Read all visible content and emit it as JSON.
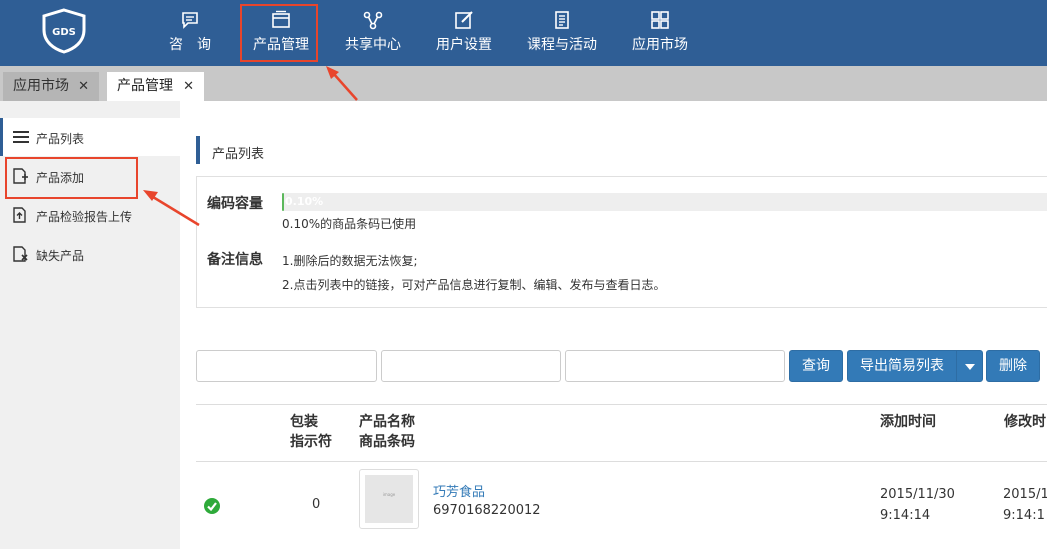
{
  "nav": {
    "logo_text": "GDS",
    "items": [
      {
        "label": "咨　询",
        "icon": "chat-icon"
      },
      {
        "label": "产品管理",
        "icon": "window-icon"
      },
      {
        "label": "共享中心",
        "icon": "share-icon"
      },
      {
        "label": "用户设置",
        "icon": "edit-icon"
      },
      {
        "label": "课程与活动",
        "icon": "document-icon"
      },
      {
        "label": "应用市场",
        "icon": "grid-icon"
      }
    ]
  },
  "tabs": [
    {
      "label": "应用市场",
      "close": "✕"
    },
    {
      "label": "产品管理",
      "close": "✕"
    }
  ],
  "sidebar": {
    "items": [
      {
        "label": "产品列表",
        "icon": "list-icon"
      },
      {
        "label": "产品添加",
        "icon": "add-document-icon"
      },
      {
        "label": "产品检验报告上传",
        "icon": "upload-document-icon"
      },
      {
        "label": "缺失产品",
        "icon": "missing-document-icon"
      }
    ]
  },
  "main": {
    "section_title": "产品列表",
    "info": {
      "capacity_label": "编码容量",
      "progress_text": "0.10%",
      "progress_value": 0.001,
      "usage_text": "0.10%的商品条码已使用",
      "notes_label": "备注信息",
      "note_1": "1.删除后的数据无法恢复;",
      "note_2": "2.点击列表中的链接，可对产品信息进行复制、编辑、发布与查看日志。"
    },
    "search": {
      "input_1_value": "",
      "input_2_value": "",
      "input_3_value": "",
      "query_label": "查询",
      "export_label": "导出简易列表",
      "delete_label": "删除"
    },
    "table": {
      "headers": {
        "indicator_line1": "包装",
        "indicator_line2": "指示符",
        "name_line1": "产品名称",
        "name_line2": "商品条码",
        "added": "添加时间",
        "modified": "修改时"
      },
      "rows": [
        {
          "status_icon": "check-circle-icon",
          "indicator": "0",
          "thumb_text": "image",
          "name": "巧芳食品",
          "barcode": "6970168220012",
          "added_date": "2015/11/30",
          "added_time": "9:14:14",
          "modified_date": "2015/1",
          "modified_time": "9:14:1"
        }
      ]
    }
  },
  "colors": {
    "nav_bg": "#2f5e95",
    "highlight": "#e8452c",
    "button": "#337ab7",
    "success": "#5cb85c",
    "link": "#337ab7"
  }
}
